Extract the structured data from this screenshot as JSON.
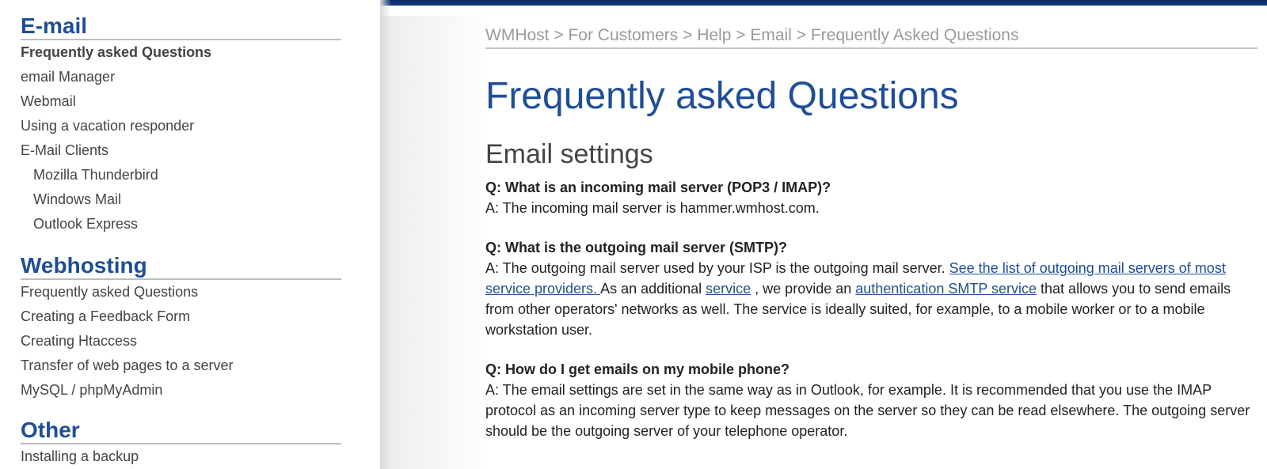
{
  "sidebar": {
    "sections": [
      {
        "heading": "E-mail",
        "items": [
          {
            "label": "Frequently asked Questions",
            "active": true
          },
          {
            "label": "email Manager"
          },
          {
            "label": "Webmail"
          },
          {
            "label": "Using a vacation responder"
          },
          {
            "label": "E-Mail Clients"
          },
          {
            "label": "Mozilla Thunderbird",
            "sub": true
          },
          {
            "label": "Windows Mail",
            "sub": true
          },
          {
            "label": "Outlook Express",
            "sub": true
          }
        ]
      },
      {
        "heading": "Webhosting",
        "items": [
          {
            "label": "Frequently asked Questions"
          },
          {
            "label": "Creating a Feedback Form"
          },
          {
            "label": "Creating Htaccess"
          },
          {
            "label": "Transfer of web pages to a server"
          },
          {
            "label": "MySQL / phpMyAdmin"
          }
        ]
      },
      {
        "heading": "Other",
        "items": [
          {
            "label": "Installing a backup"
          }
        ]
      }
    ]
  },
  "breadcrumb": {
    "items": [
      "WMHost",
      "For Customers",
      "Help",
      "Email",
      "Frequently Asked Questions"
    ],
    "separator": " > "
  },
  "main": {
    "title": "Frequently asked Questions",
    "section_title": "Email settings",
    "faqs": [
      {
        "q": "Q: What is an incoming mail server (POP3 / IMAP)?",
        "a_parts": [
          {
            "text": "A: The incoming mail server is hammer.wmhost.com."
          }
        ]
      },
      {
        "q": "Q: What is the outgoing mail server (SMTP)?",
        "a_parts": [
          {
            "text": "A: The outgoing mail server used by your ISP is the outgoing mail server. "
          },
          {
            "text": "See the list of outgoing mail servers of most service providers. ",
            "link": true
          },
          {
            "text": "As an additional "
          },
          {
            "text": "service",
            "link": true
          },
          {
            "text": " , we provide an "
          },
          {
            "text": "authentication SMTP service",
            "link": true
          },
          {
            "text": " that allows you to send emails from other operators' networks as well. The service is ideally suited, for example, to a mobile worker or to a mobile workstation user."
          }
        ]
      },
      {
        "q": "Q: How do I get emails on my mobile phone?",
        "a_parts": [
          {
            "text": "A: The email settings are set in the same way as in Outlook, for example. It is recommended that you use the IMAP protocol as an incoming server type to keep messages on the server so they can be read elsewhere. The outgoing server should be the outgoing server of your telephone operator."
          }
        ]
      }
    ]
  },
  "colors": {
    "accent": "#1f4e96",
    "topbar": "#0b2a66",
    "breadcrumb": "#9a9a9a",
    "text": "#222222"
  }
}
